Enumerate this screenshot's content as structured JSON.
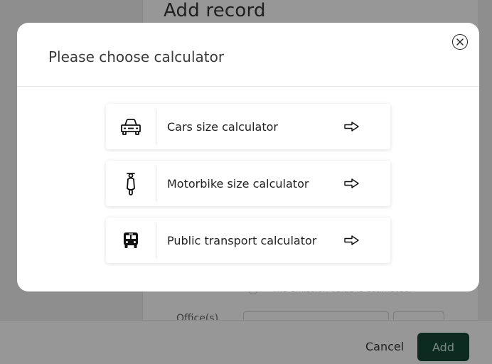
{
  "background": {
    "title": "Add record",
    "radio_label": "The emission value is estimated.",
    "office_label": "Office(s)",
    "cancel_label": "Cancel",
    "add_label": "Add"
  },
  "modal": {
    "title": "Please choose calculator",
    "options": [
      {
        "label": "Cars size calculator",
        "icon": "car-icon"
      },
      {
        "label": "Motorbike size calculator",
        "icon": "motorbike-icon"
      },
      {
        "label": "Public transport calculator",
        "icon": "bus-icon"
      }
    ]
  },
  "colors": {
    "overlay": "#8f8f8f",
    "primary_button": "#0b2a20",
    "modal_bg": "#ffffff"
  }
}
